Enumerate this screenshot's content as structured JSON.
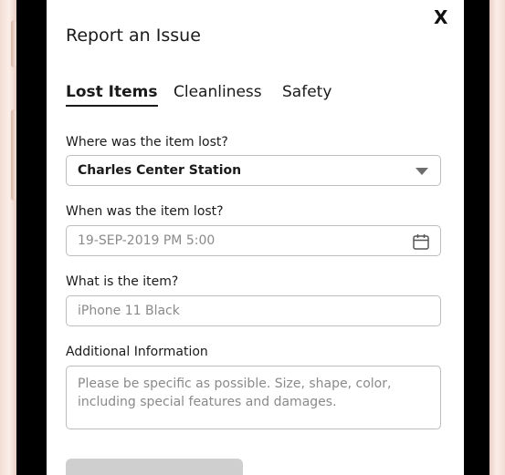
{
  "modal": {
    "title": "Report an Issue",
    "close_label": "X"
  },
  "tabs": [
    {
      "label": "Lost Items",
      "active": true
    },
    {
      "label": "Cleanliness",
      "active": false
    },
    {
      "label": "Safety",
      "active": false
    }
  ],
  "form": {
    "location": {
      "label": "Where was the item lost?",
      "value": "Charles Center Station"
    },
    "datetime": {
      "label": "When was the item lost?",
      "placeholder": "19-SEP-2019   PM 5:00"
    },
    "item": {
      "label": "What is the item?",
      "placeholder": "iPhone 11 Black"
    },
    "additional": {
      "label": "Additional Information",
      "placeholder": "Please be specific as possible. Size, shape, color, including special features and damages."
    }
  },
  "icons": {
    "close": "close-icon",
    "dropdown": "chevron-down-icon",
    "calendar": "calendar-icon"
  },
  "colors": {
    "frame": "#f2ddd4",
    "field_border": "#bdbdbd",
    "placeholder": "#8a8a8a",
    "submit_disabled": "#cfcfcf"
  }
}
